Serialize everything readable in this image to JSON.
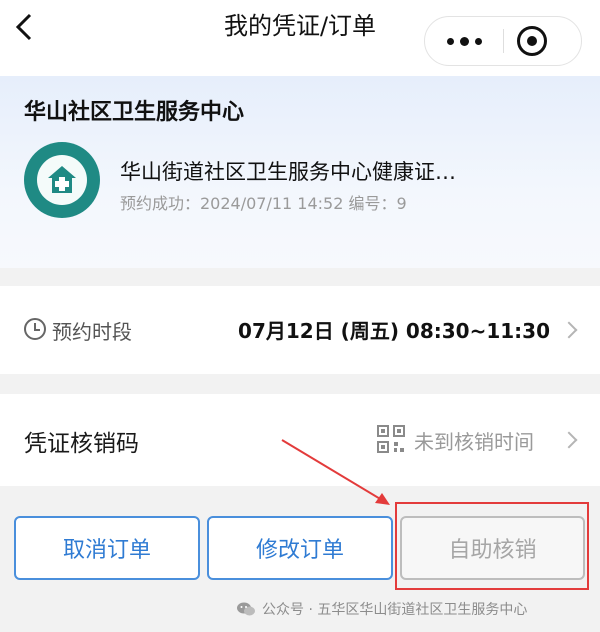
{
  "nav": {
    "back_icon": "chevron-left-icon",
    "title": "我的凭证/订单",
    "more_icon": "more-dots-icon",
    "close_icon": "target-close-icon"
  },
  "org": {
    "name": "华山社区卫生服务中心",
    "logo_icon": "health-center-logo",
    "service_name": "华山街道社区卫生服务中心健康证…",
    "meta": "预约成功：2024/07/11 14:52  编号：9"
  },
  "appointment": {
    "label": "预约时段",
    "value": "07月12日 (周五) 08:30~11:30",
    "icon": "clock-icon"
  },
  "voucher": {
    "label": "凭证核销码",
    "status": "未到核销时间",
    "icon": "qr-code-icon"
  },
  "buttons": {
    "cancel": "取消订单",
    "modify": "修改订单",
    "self_verify": "自助核销"
  },
  "watermark": {
    "text": "公众号 · 五华区华山街道社区卫生服务中心",
    "icon": "wechat-icon"
  },
  "colors": {
    "accent_blue": "#2f7bd3",
    "annotation_red": "#e33b3b",
    "logo_teal": "#1f8a84"
  }
}
